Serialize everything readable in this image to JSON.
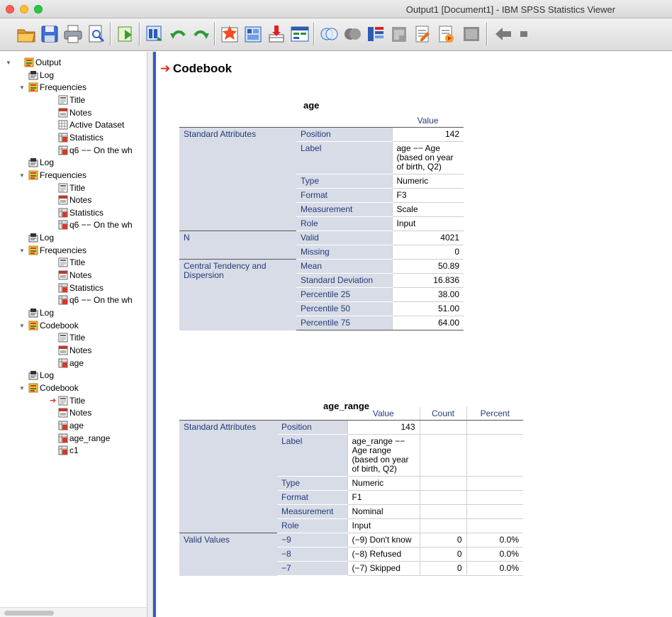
{
  "window": {
    "title": "Output1 [Document1] - IBM SPSS Statistics Viewer"
  },
  "toolbar": {
    "icons": [
      "open-icon",
      "save-icon",
      "print-icon",
      "print-preview-icon",
      "export-icon",
      "recall-dialog-icon",
      "undo-icon",
      "redo-icon",
      "goto-case-icon",
      "goto-variable-icon",
      "variables-icon",
      "value-labels-icon",
      "select-cases-icon",
      "weight-cases-icon",
      "split-file-icon",
      "designate-window-icon",
      "insert-heading-icon",
      "insert-title-icon",
      "insert-text-icon",
      "collapse-icon",
      "back-icon",
      "forward-icon"
    ]
  },
  "tree": [
    {
      "label": "Output",
      "level": 0,
      "icon": "output-book-icon",
      "expander": true
    },
    {
      "label": "Log",
      "level": 1,
      "icon": "log-icon"
    },
    {
      "label": "Frequencies",
      "level": 1,
      "icon": "procedure-book-icon",
      "expander": true
    },
    {
      "label": "Title",
      "level": 2,
      "icon": "title-icon"
    },
    {
      "label": "Notes",
      "level": 2,
      "icon": "notes-icon"
    },
    {
      "label": "Active Dataset",
      "level": 2,
      "icon": "dataset-icon"
    },
    {
      "label": "Statistics",
      "level": 2,
      "icon": "table-icon"
    },
    {
      "label": "q6 -- On the wh",
      "level": 2,
      "icon": "table-icon"
    },
    {
      "label": "Log",
      "level": 1,
      "icon": "log-icon"
    },
    {
      "label": "Frequencies",
      "level": 1,
      "icon": "procedure-book-icon",
      "expander": true
    },
    {
      "label": "Title",
      "level": 2,
      "icon": "title-icon"
    },
    {
      "label": "Notes",
      "level": 2,
      "icon": "notes-icon"
    },
    {
      "label": "Statistics",
      "level": 2,
      "icon": "table-icon"
    },
    {
      "label": "q6 -- On the wh",
      "level": 2,
      "icon": "table-icon"
    },
    {
      "label": "Log",
      "level": 1,
      "icon": "log-icon"
    },
    {
      "label": "Frequencies",
      "level": 1,
      "icon": "procedure-book-icon",
      "expander": true
    },
    {
      "label": "Title",
      "level": 2,
      "icon": "title-icon"
    },
    {
      "label": "Notes",
      "level": 2,
      "icon": "notes-icon"
    },
    {
      "label": "Statistics",
      "level": 2,
      "icon": "table-icon"
    },
    {
      "label": "q6 -- On the wh",
      "level": 2,
      "icon": "table-icon"
    },
    {
      "label": "Log",
      "level": 1,
      "icon": "log-icon"
    },
    {
      "label": "Codebook",
      "level": 1,
      "icon": "procedure-book-icon",
      "expander": true
    },
    {
      "label": "Title",
      "level": 2,
      "icon": "title-icon"
    },
    {
      "label": "Notes",
      "level": 2,
      "icon": "notes-icon"
    },
    {
      "label": "age",
      "level": 2,
      "icon": "table-icon"
    },
    {
      "label": "Log",
      "level": 1,
      "icon": "log-icon"
    },
    {
      "label": "Codebook",
      "level": 1,
      "icon": "procedure-book-icon",
      "expander": true
    },
    {
      "label": "Title",
      "level": 2,
      "icon": "title-icon",
      "current": true
    },
    {
      "label": "Notes",
      "level": 2,
      "icon": "notes-icon"
    },
    {
      "label": "age",
      "level": 2,
      "icon": "table-icon"
    },
    {
      "label": "age_range",
      "level": 2,
      "icon": "table-icon"
    },
    {
      "label": "c1",
      "level": 2,
      "icon": "table-icon"
    }
  ],
  "content": {
    "heading": "Codebook",
    "age_table": {
      "title": "age",
      "value_header": "Value",
      "groups": [
        {
          "label": "Standard Attributes",
          "rows": [
            [
              "Position",
              "142"
            ],
            [
              "Label",
              "age -- Age (based on year of birth, Q2)"
            ],
            [
              "Type",
              "Numeric"
            ],
            [
              "Format",
              "F3"
            ],
            [
              "Measurement",
              "Scale"
            ],
            [
              "Role",
              "Input"
            ]
          ]
        },
        {
          "label": "N",
          "rows": [
            [
              "Valid",
              "4021"
            ],
            [
              "Missing",
              "0"
            ]
          ]
        },
        {
          "label": "Central Tendency and Dispersion",
          "rows": [
            [
              "Mean",
              "50.89"
            ],
            [
              "Standard Deviation",
              "16.836"
            ],
            [
              "Percentile 25",
              "38.00"
            ],
            [
              "Percentile 50",
              "51.00"
            ],
            [
              "Percentile 75",
              "64.00"
            ]
          ]
        }
      ]
    },
    "age_range_table": {
      "title": "age_range",
      "headers": [
        "Value",
        "Count",
        "Percent"
      ],
      "groups": [
        {
          "label": "Standard Attributes",
          "rows": [
            [
              "Position",
              "143",
              "",
              ""
            ],
            [
              "Label",
              "age_range -- Age range (based on year of birth, Q2)",
              "",
              ""
            ],
            [
              "Type",
              "Numeric",
              "",
              ""
            ],
            [
              "Format",
              "F1",
              "",
              ""
            ],
            [
              "Measurement",
              "Nominal",
              "",
              ""
            ],
            [
              "Role",
              "Input",
              "",
              ""
            ]
          ]
        },
        {
          "label": "Valid Values",
          "rows": [
            [
              "-9",
              "(-9) Don't know",
              "0",
              "0.0%"
            ],
            [
              "-8",
              "(-8) Refused",
              "0",
              "0.0%"
            ],
            [
              "-7",
              "(-7) Skipped",
              "0",
              "0.0%"
            ]
          ]
        }
      ]
    }
  }
}
